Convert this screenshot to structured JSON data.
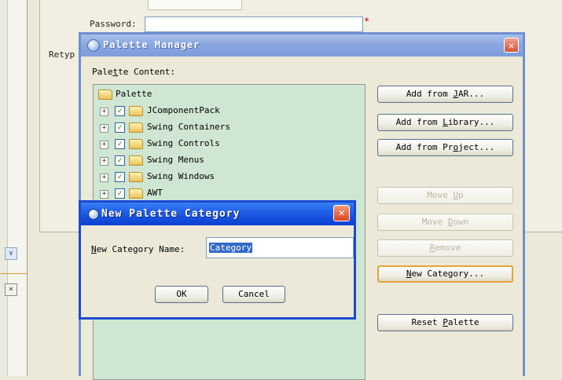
{
  "background_form": {
    "password_label": "Password:",
    "required_marker": "*",
    "retype_label": "Retyp"
  },
  "left_panel": {
    "chevron_icon": "chevron-down-icon",
    "close_icon": "close-icon",
    "chevron_glyph": "∨",
    "close_glyph": "×"
  },
  "palette_manager": {
    "title": "Palette Manager",
    "close_glyph": "✕",
    "content_label_pre": "Pale",
    "content_label_mn": "t",
    "content_label_post": "te Content:",
    "tree": {
      "root": "Palette",
      "items": [
        {
          "label": "JComponentPack",
          "checked": true
        },
        {
          "label": "Swing Containers",
          "checked": true
        },
        {
          "label": "Swing Controls",
          "checked": true
        },
        {
          "label": "Swing Menus",
          "checked": true
        },
        {
          "label": "Swing Windows",
          "checked": true
        },
        {
          "label": "AWT",
          "checked": true
        }
      ],
      "expander_glyph": "+",
      "check_glyph": "✓"
    },
    "buttons": {
      "add_jar_pre": "Add from ",
      "add_jar_mn": "J",
      "add_jar_post": "AR...",
      "add_library_pre": "Add from ",
      "add_library_mn": "L",
      "add_library_post": "ibrary...",
      "add_project_pre": "Add from Pr",
      "add_project_mn": "o",
      "add_project_post": "ject...",
      "move_up_pre": "Move ",
      "move_up_mn": "U",
      "move_up_post": "p",
      "move_down_pre": "Move ",
      "move_down_mn": "D",
      "move_down_post": "own",
      "remove_pre": "",
      "remove_mn": "R",
      "remove_post": "emove",
      "new_category_pre": "",
      "new_category_mn": "N",
      "new_category_post": "ew Category...",
      "reset_palette_pre": "Reset ",
      "reset_palette_mn": "P",
      "reset_palette_post": "alette"
    }
  },
  "new_category_dialog": {
    "title": "New Palette Category",
    "close_glyph": "✕",
    "name_label_mn": "N",
    "name_label_post": "ew Category Name:",
    "name_value": "Category",
    "ok_label": "OK",
    "cancel_label": "Cancel"
  },
  "colors": {
    "tree_background": "#cfe6d2",
    "active_title": "#1e5ce6",
    "inactive_title": "#8aa7e0",
    "selection": "#316ac5"
  }
}
